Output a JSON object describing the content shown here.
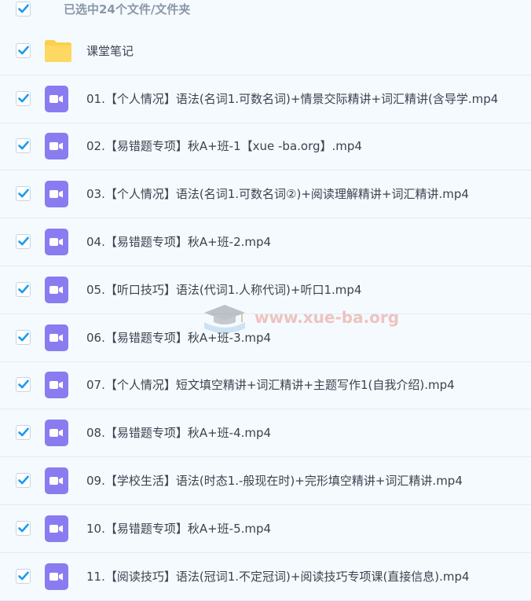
{
  "header": {
    "selection_text": "已选中24个文件/文件夹"
  },
  "items": [
    {
      "type": "folder",
      "name": "课堂笔记",
      "checked": true
    },
    {
      "type": "video",
      "name": "01.【个人情况】语法(名词1.可数名词)+情景交际精讲+词汇精讲(含导学.mp4",
      "checked": true
    },
    {
      "type": "video",
      "name": "02.【易错题专项】秋A+班-1【xue -ba.org】.mp4",
      "checked": true
    },
    {
      "type": "video",
      "name": "03.【个人情况】语法(名词1.可数名词②)+阅读理解精讲+词汇精讲.mp4",
      "checked": true
    },
    {
      "type": "video",
      "name": "04.【易错题专项】秋A+班-2.mp4",
      "checked": true
    },
    {
      "type": "video",
      "name": "05.【听口技巧】语法(代词1.人称代词)+听口1.mp4",
      "checked": true
    },
    {
      "type": "video",
      "name": "06.【易错题专项】秋A+班-3.mp4",
      "checked": true
    },
    {
      "type": "video",
      "name": "07.【个人情况】短文填空精讲+词汇精讲+主题写作1(自我介绍).mp4",
      "checked": true
    },
    {
      "type": "video",
      "name": "08.【易错题专项】秋A+班-4.mp4",
      "checked": true
    },
    {
      "type": "video",
      "name": "09.【学校生活】语法(时态1.-般现在时)+完形填空精讲+词汇精讲.mp4",
      "checked": true
    },
    {
      "type": "video",
      "name": "10.【易错题专项】秋A+班-5.mp4",
      "checked": true
    },
    {
      "type": "video",
      "name": "11.【阅读技巧】语法(冠词1.不定冠词)+阅读技巧专项课(直接信息).mp4",
      "checked": true
    }
  ],
  "watermark": {
    "text": "www.xue-ba.org"
  },
  "colors": {
    "checkbox_check": "#1a9bf0",
    "video_icon": "#8a7cf0",
    "folder_icon": "#fccf4d",
    "row_border": "#e2ebf3",
    "background": "#f5fafe"
  }
}
